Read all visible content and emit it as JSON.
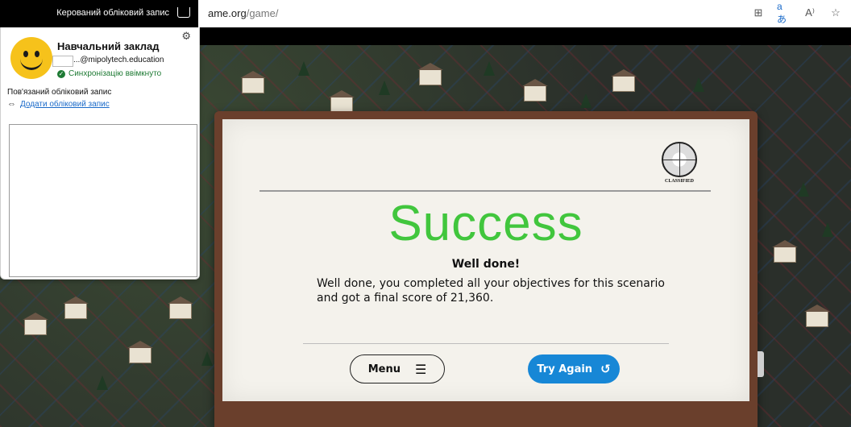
{
  "browser": {
    "url_host": "ame.org",
    "url_path": "/game/",
    "toolbar_icons": [
      "split-screen-icon",
      "translate-icon",
      "read-aloud-icon",
      "favorite-star-icon"
    ],
    "translate_glyph": "aあ",
    "read_aloud_glyph": "A⁾",
    "split_glyph": "⊞",
    "star_glyph": "☆"
  },
  "account": {
    "header_label": "Керований обліковий запис",
    "org_name": "Навчальний заклад",
    "email_suffix": "...@mipolytech.education",
    "sync_status": "Синхронізацію ввімкнуто",
    "linked_title": "Пов'язаний обліковий запис",
    "add_account": "Додати обліковий запис",
    "colors": {
      "avatar": "#f6c21b",
      "sync_green": "#1e7a34",
      "link_blue": "#1a6ac9"
    }
  },
  "dialog": {
    "logo_label": "CLASSIFIED",
    "title": "Success",
    "subtitle": "Well done!",
    "message": "Well done, you completed all your objectives for this scenario and got a final score of 21,360.",
    "menu_label": "Menu",
    "try_again_label": "Try Again",
    "colors": {
      "title_green": "#41c63d",
      "try_again_blue": "#1787d6",
      "frame_brown": "#6a3f2c",
      "paper": "#f4f2ec"
    }
  }
}
